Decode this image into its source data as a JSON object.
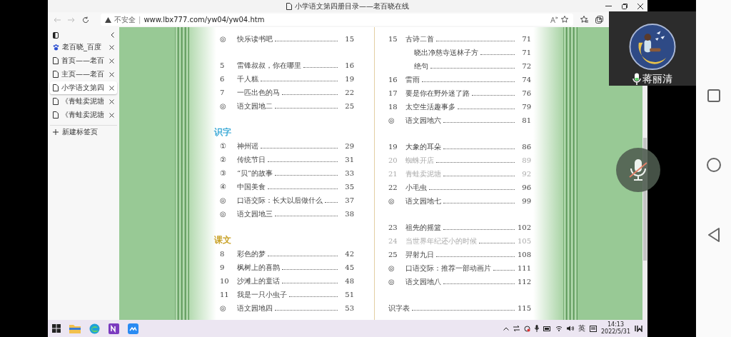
{
  "browser": {
    "title": "小学语文第四册目录——老百晓在线",
    "security": "不安全",
    "separator": "|",
    "url": "www.lbx777.com/yw04/yw04.htm",
    "tabs": [
      {
        "label": "老百晓_百度",
        "kind": "paw",
        "selected": false
      },
      {
        "label": "首页——老百",
        "kind": "page",
        "selected": false
      },
      {
        "label": "主页——老百",
        "kind": "page",
        "selected": false
      },
      {
        "label": "小学语文第四",
        "kind": "page",
        "selected": true
      },
      {
        "label": "《青蛙卖泥塘",
        "kind": "page",
        "selected": false
      },
      {
        "label": "《青蛙卖泥塘",
        "kind": "page",
        "selected": false
      }
    ],
    "new_tab": "新建标签页"
  },
  "book": {
    "left_page": [
      {
        "items": [
          {
            "kind": "lesson",
            "marker": "◎",
            "title": "快乐读书吧",
            "page": "15",
            "faded": false
          }
        ]
      },
      {
        "items": [
          {
            "kind": "lesson",
            "marker": "5",
            "title": "雷锋叔叔，你在哪里",
            "page": "16",
            "faded": false
          },
          {
            "kind": "lesson",
            "marker": "6",
            "title": "千人糕",
            "page": "19",
            "faded": false
          },
          {
            "kind": "lesson",
            "marker": "7",
            "title": "一匹出色的马",
            "page": "22",
            "faded": false
          },
          {
            "kind": "lesson",
            "marker": "◎",
            "title": "语文园地二",
            "page": "25",
            "faded": false
          }
        ]
      },
      {
        "heading": "识字",
        "color": "#3aa9d6",
        "items": [
          {
            "kind": "lesson",
            "marker": "①",
            "title": "神州谣",
            "page": "29",
            "faded": false
          },
          {
            "kind": "lesson",
            "marker": "②",
            "title": "传统节日",
            "page": "31",
            "faded": false
          },
          {
            "kind": "lesson",
            "marker": "③",
            "title": "“贝”的故事",
            "page": "33",
            "faded": false
          },
          {
            "kind": "lesson",
            "marker": "④",
            "title": "中国美食",
            "page": "35",
            "faded": false
          },
          {
            "kind": "lesson",
            "marker": "◎",
            "title": "口语交际：长大以后做什么",
            "page": "37",
            "faded": false
          },
          {
            "kind": "lesson",
            "marker": "◎",
            "title": "语文园地三",
            "page": "38",
            "faded": false
          }
        ]
      },
      {
        "heading": "课文",
        "color": "#c9a227",
        "items": [
          {
            "kind": "lesson",
            "marker": "8",
            "title": "彩色的梦",
            "page": "42",
            "faded": false
          },
          {
            "kind": "lesson",
            "marker": "9",
            "title": "枫树上的喜鹊",
            "page": "45",
            "faded": false
          },
          {
            "kind": "lesson",
            "marker": "10",
            "title": "沙滩上的童话",
            "page": "48",
            "faded": false
          },
          {
            "kind": "lesson",
            "marker": "11",
            "title": "我是一只小虫子",
            "page": "51",
            "faded": false
          },
          {
            "kind": "lesson",
            "marker": "◎",
            "title": "语文园地四",
            "page": "53",
            "faded": false
          }
        ]
      }
    ],
    "right_page": [
      {
        "items": [
          {
            "kind": "lesson",
            "marker": "15",
            "title": "古诗二首",
            "page": "71",
            "faded": false
          },
          {
            "kind": "sub",
            "title": "晓出净慈寺送林子方",
            "page": "71",
            "faded": false
          },
          {
            "kind": "sub",
            "title": "绝句",
            "page": "72",
            "faded": false
          },
          {
            "kind": "lesson",
            "marker": "16",
            "title": "雷雨",
            "page": "74",
            "faded": false
          },
          {
            "kind": "lesson",
            "marker": "17",
            "title": "要是你在野外迷了路",
            "page": "76",
            "faded": false
          },
          {
            "kind": "lesson",
            "marker": "18",
            "title": "太空生活趣事多",
            "page": "79",
            "faded": false
          },
          {
            "kind": "lesson",
            "marker": "◎",
            "title": "语文园地六",
            "page": "81",
            "faded": false
          }
        ]
      },
      {
        "items": [
          {
            "kind": "lesson",
            "marker": "19",
            "title": "大象的耳朵",
            "page": "86",
            "faded": false
          },
          {
            "kind": "lesson",
            "marker": "20",
            "title": "蜘蛛开店",
            "page": "89",
            "faded": true
          },
          {
            "kind": "lesson",
            "marker": "21",
            "title": "青蛙卖泥塘",
            "page": "92",
            "faded": true
          },
          {
            "kind": "lesson",
            "marker": "22",
            "title": "小毛虫",
            "page": "96",
            "faded": false
          },
          {
            "kind": "lesson",
            "marker": "◎",
            "title": "语文园地七",
            "page": "99",
            "faded": false
          }
        ]
      },
      {
        "items": [
          {
            "kind": "lesson",
            "marker": "23",
            "title": "祖先的摇篮",
            "page": "102",
            "faded": false
          },
          {
            "kind": "lesson",
            "marker": "24",
            "title": "当世界年纪还小的时候",
            "page": "105",
            "faded": true
          },
          {
            "kind": "lesson",
            "marker": "25",
            "title": "羿射九日",
            "page": "108",
            "faded": false
          },
          {
            "kind": "lesson",
            "marker": "◎",
            "title": "口语交际：推荐一部动画片",
            "page": "111",
            "faded": false
          },
          {
            "kind": "lesson",
            "marker": "◎",
            "title": "语文园地八",
            "page": "112",
            "faded": false
          }
        ]
      },
      {
        "items": [
          {
            "kind": "plain",
            "title": "识字表",
            "page": "115",
            "faded": false
          }
        ]
      }
    ]
  },
  "taskbar": {
    "input_method": "英",
    "time": "14:13",
    "date": "2022/5/31"
  },
  "call": {
    "name": "蒋丽清",
    "mic_muted": true
  }
}
